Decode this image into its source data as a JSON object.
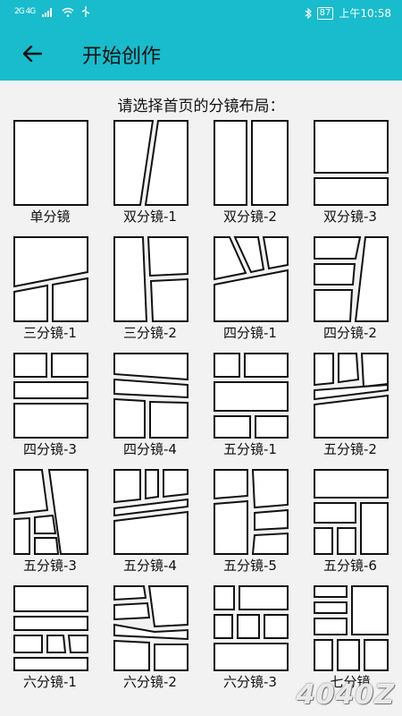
{
  "status_bar": {
    "network": "2G 4G",
    "time": "上午10:58",
    "battery": "87",
    "icons": [
      "signal-icon",
      "wifi-icon",
      "usb-icon",
      "bluetooth-icon",
      "battery-icon"
    ]
  },
  "app_bar": {
    "title": "开始创作",
    "back_icon": "arrow-left-icon",
    "color": "#18bccc"
  },
  "subtitle": "请选择首页的分镜布局：",
  "layouts": [
    {
      "label": "单分镜"
    },
    {
      "label": "双分镜-1"
    },
    {
      "label": "双分镜-2"
    },
    {
      "label": "双分镜-3"
    },
    {
      "label": "三分镜-1"
    },
    {
      "label": "三分镜-2"
    },
    {
      "label": "四分镜-1"
    },
    {
      "label": "四分镜-2"
    },
    {
      "label": "四分镜-3"
    },
    {
      "label": "四分镜-4"
    },
    {
      "label": "五分镜-1"
    },
    {
      "label": "五分镜-2"
    },
    {
      "label": "五分镜-3"
    },
    {
      "label": "五分镜-4"
    },
    {
      "label": "五分镜-5"
    },
    {
      "label": "五分镜-6"
    },
    {
      "label": "六分镜-1"
    },
    {
      "label": "六分镜-2"
    },
    {
      "label": "六分镜-3"
    },
    {
      "label": "七分镜"
    }
  ],
  "watermark": "4040Z"
}
